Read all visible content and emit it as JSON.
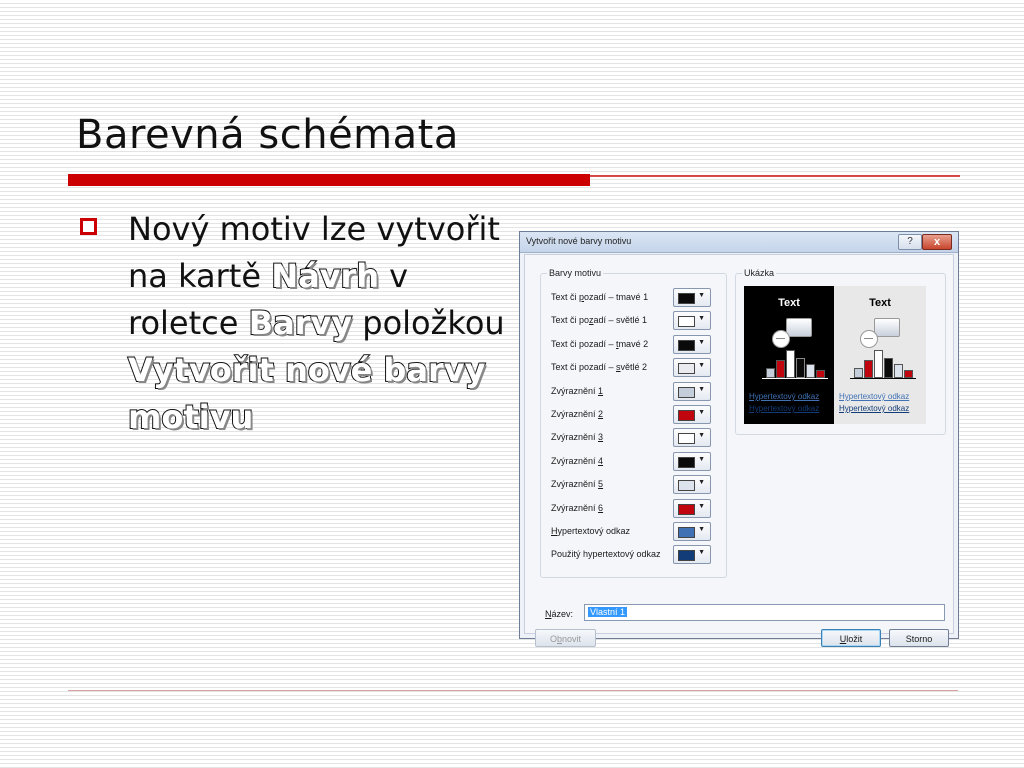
{
  "slide": {
    "title": "Barevná schémata",
    "bullet": {
      "part1": "Nový motiv lze vytvořit na kartě",
      "tab": "Návrh",
      "part2": "v roletce",
      "dropdown": "Barvy",
      "part3": "položkou",
      "command": "Vytvořit nové barvy motivu"
    }
  },
  "dialog": {
    "title": "Vytvořit nové barvy motivu",
    "help_label": "?",
    "close_label": "x",
    "colors_group": "Barvy motivu",
    "preview_group": "Ukázka",
    "rows": [
      {
        "pre": "Text či ",
        "u": "p",
        "post": "ozadí – tmavé 1",
        "color": "#0a0a0a"
      },
      {
        "pre": "Text či po",
        "u": "z",
        "post": "adí – světlé 1",
        "color": "#ffffff"
      },
      {
        "pre": "Text či pozadí – ",
        "u": "t",
        "post": "mavé 2",
        "color": "#0a0a0a"
      },
      {
        "pre": "Text či pozadí – ",
        "u": "s",
        "post": "větlé 2",
        "color": "#e9ebee"
      },
      {
        "pre": "Zvýraznění ",
        "u": "1",
        "post": "",
        "color": "#c4cedb"
      },
      {
        "pre": "Zvýraznění ",
        "u": "2",
        "post": "",
        "color": "#c0050e"
      },
      {
        "pre": "Zvýraznění ",
        "u": "3",
        "post": "",
        "color": "#ffffff"
      },
      {
        "pre": "Zvýraznění ",
        "u": "4",
        "post": "",
        "color": "#0a0a0a"
      },
      {
        "pre": "Zvýraznění ",
        "u": "5",
        "post": "",
        "color": "#dce3ec"
      },
      {
        "pre": "Zvýraznění ",
        "u": "6",
        "post": "",
        "color": "#c0050e"
      },
      {
        "pre": "",
        "u": "H",
        "post": "ypertextový odkaz",
        "color": "#3f71b4"
      },
      {
        "pre": "Použitý hypertextový odkaz",
        "u": "",
        "post": "",
        "color": "#123c78"
      }
    ],
    "preview": {
      "dark": {
        "text": "Text",
        "link": "Hypertextový odkaz",
        "visited_link": "Hypertextový odkaz",
        "bg": "#000000",
        "text_color": "#ffffff",
        "link_color": "#3f71b4",
        "visited_color": "#123c78"
      },
      "light": {
        "text": "Text",
        "link": "Hypertextový odkaz",
        "visited_link": "Hypertextový odkaz",
        "bg": "#e9e9e9",
        "text_color": "#000000",
        "link_color": "#3f71b4",
        "visited_color": "#123c78"
      }
    },
    "name_label_u": "N",
    "name_label_rest": "ázev:",
    "name_value": "Vlastní 1",
    "reset_pre": "O",
    "reset_u": "b",
    "reset_post": "novit",
    "save_u": "U",
    "save_post": "ložit",
    "cancel_label": "Storno"
  },
  "colors": {
    "accent": "#cc0000",
    "bullet_border": "#cc0000"
  },
  "icons": {
    "bullet": "hollow-square-bullet",
    "dropdown": "dropdown-arrow-icon",
    "help": "help-icon",
    "close": "close-icon"
  }
}
